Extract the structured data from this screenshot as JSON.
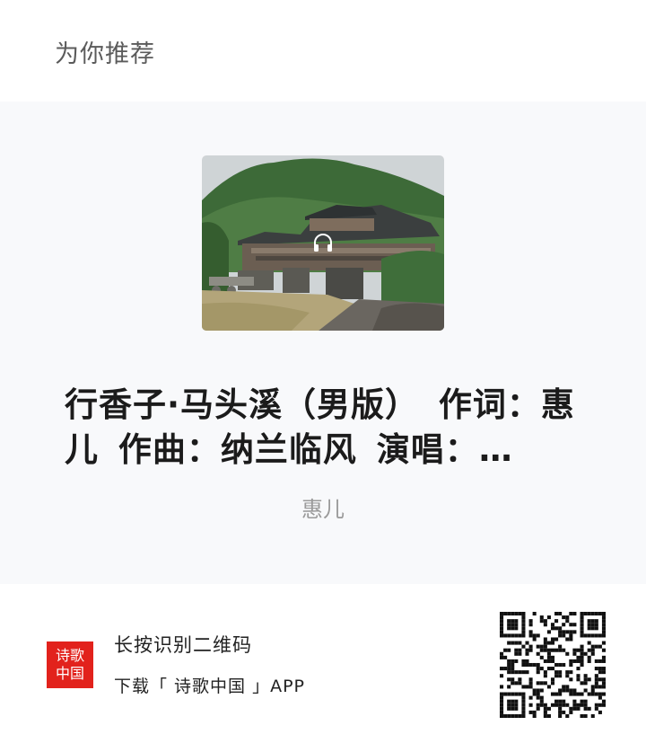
{
  "header": {
    "title": "为你推荐"
  },
  "card": {
    "cover_icon": "headphone-icon",
    "title": "行香子·马头溪（男版） 作词：惠儿 作曲：纳兰临风 演唱：…",
    "author": "惠儿"
  },
  "footer": {
    "logo_chars": [
      "诗歌",
      "中国"
    ],
    "line1": "长按识别二维码",
    "line2": "下载「 诗歌中国 」APP"
  },
  "colors": {
    "logo_red": "#e2221c",
    "card_bg": "#f8f9fb"
  }
}
